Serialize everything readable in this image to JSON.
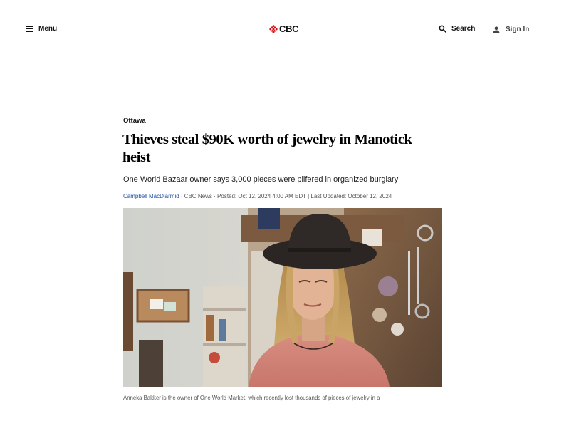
{
  "header": {
    "menu_label": "Menu",
    "logo_text": "CBC",
    "search_label": "Search",
    "signin_label": "Sign In"
  },
  "article": {
    "section": "Ottawa",
    "headline": "Thieves steal $90K worth of jewelry in Manotick heist",
    "dek": "One World Bazaar owner says 3,000 pieces were pilfered in organized burglary",
    "byline": {
      "author": "Campbell MacDiarmid",
      "source": " · CBC News · ",
      "posted": "Posted: Oct 12, 2024 4:00 AM EDT",
      "separator": " | ",
      "updated": "Last Updated: October 12, 2024"
    },
    "caption": "Anneka Bakker is the owner of One World Market, which recently lost thousands of pieces of jewelry in a"
  },
  "colors": {
    "brand_red": "#d4161c",
    "link_blue": "#1f4fa3"
  },
  "icons": [
    "hamburger-icon",
    "cbc-gem-icon",
    "search-icon",
    "user-icon"
  ]
}
